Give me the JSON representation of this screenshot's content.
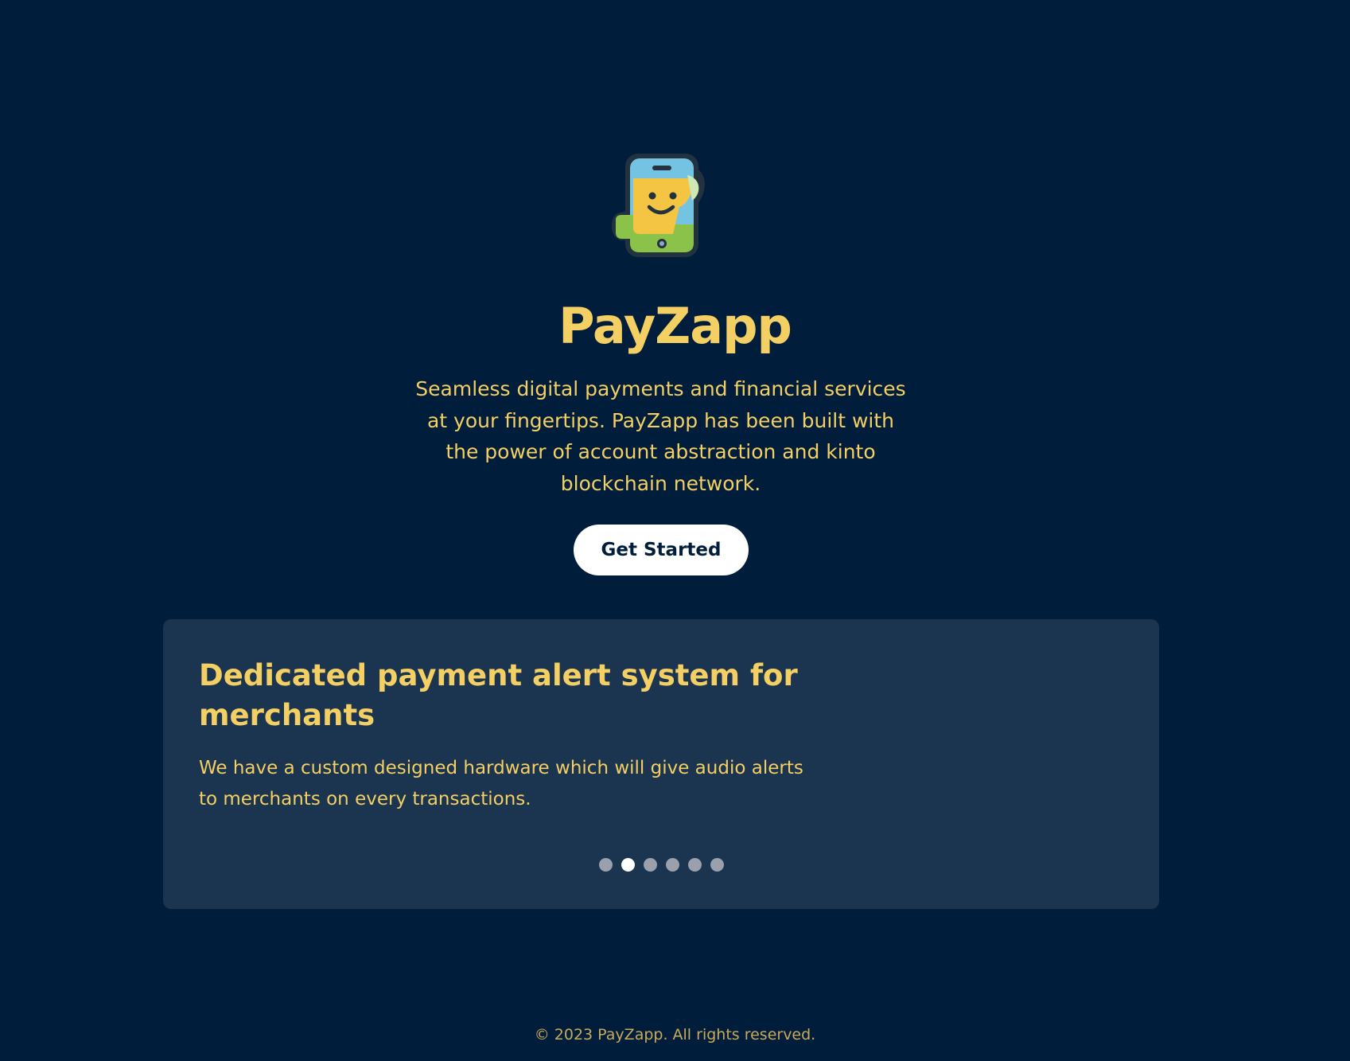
{
  "brand": {
    "name": "PayZapp",
    "logo_icon": "smiling-phone-icon",
    "tagline": "Seamless digital payments and financial services at your fingertips. PayZapp has been built with the power of account abstraction and kinto blockchain network.",
    "cta_label": "Get Started"
  },
  "carousel": {
    "slide_title": "Dedicated payment alert system for merchants",
    "slide_description": "We have a custom designed hardware which will give audio alerts to merchants on every transactions.",
    "slide_count": 6,
    "active_index": 1
  },
  "footer": {
    "text": "© 2023 PayZapp. All rights reserved."
  },
  "colors": {
    "background": "#001e3b",
    "card": "#1b3450",
    "accent": "#f4cf63",
    "button_bg": "#ffffff",
    "dot_inactive": "#9aa1ad",
    "dot_active": "#ffffff"
  }
}
